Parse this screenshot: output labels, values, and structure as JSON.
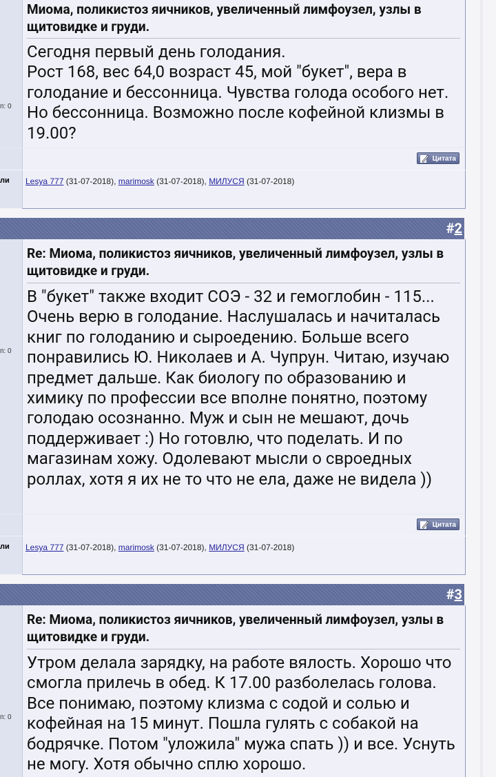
{
  "posts": [
    {
      "title": "Миома, поликистоз яичников, увеличенный лимфоузел, узлы в щитовидке и груди.",
      "body": "Сегодня первый день голодания.\nРост 168, вес 64,0 возраст 45, мой \"букет\", вера в голодание и бессонница. Чувства голода особого нет. Но бессонница. Возможно после кофейной клизмы в 19.00?",
      "side_label": "п: 0",
      "quote_label": "Цитата",
      "thanks_label": "ли"
    },
    {
      "number_hash": "#",
      "number": "2",
      "title": "Re: Миома, поликистоз яичников, увеличенный лимфоузел, узлы в щитовидке и груди.",
      "body": "В \"букет\" также входит СОЭ - 32 и гемоглобин - 115... Очень верю в голодание. Наслушалась и начиталась книг по голоданию и сыроедению. Больше всего понравились Ю. Николаев и А. Чупрун. Читаю, изучаю предмет дальше. Как биологу по образованию и химику по профессии все вполне понятно, поэтому голодаю осознанно. Муж и сын не мешают, дочь поддерживает :) Но готовлю, что поделать. И по магазинам хожу. Одолевают мысли о свроедных роллах, хотя я их не то что не ела, даже не видела ))",
      "side_label": "п: 0",
      "quote_label": "Цитата",
      "thanks_label": "ли"
    },
    {
      "number_hash": "#",
      "number": "3",
      "title": "Re: Миома, поликистоз яичников, увеличенный лимфоузел, узлы в щитовидке и груди.",
      "body": "Утром делала зарядку, на работе вялость. Хорошо что смогла прилечь в обед. К 17.00 разболелась голова. Все понимаю, поэтому клизма с содой и солью и кофейная на 15 минут. Пошла гулять с собакой на бодрячке. Потом \"уложила\" мужа спать )) и все. Уснуть не могу. Хотя обычно сплю хорошо.",
      "side_label": "п: 0"
    }
  ],
  "thanks": {
    "users": [
      {
        "name": "Lesya 777",
        "date": " (31-07-2018), "
      },
      {
        "name": "marimosk",
        "date": " (31-07-2018), "
      },
      {
        "name": "МИЛУСЯ",
        "date": " (31-07-2018)"
      }
    ]
  },
  "colors": {
    "header": "#66729f",
    "link": "#22229c",
    "pane": "#f0f1f8"
  },
  "icons": {
    "quote": "quote-pencil-icon"
  }
}
